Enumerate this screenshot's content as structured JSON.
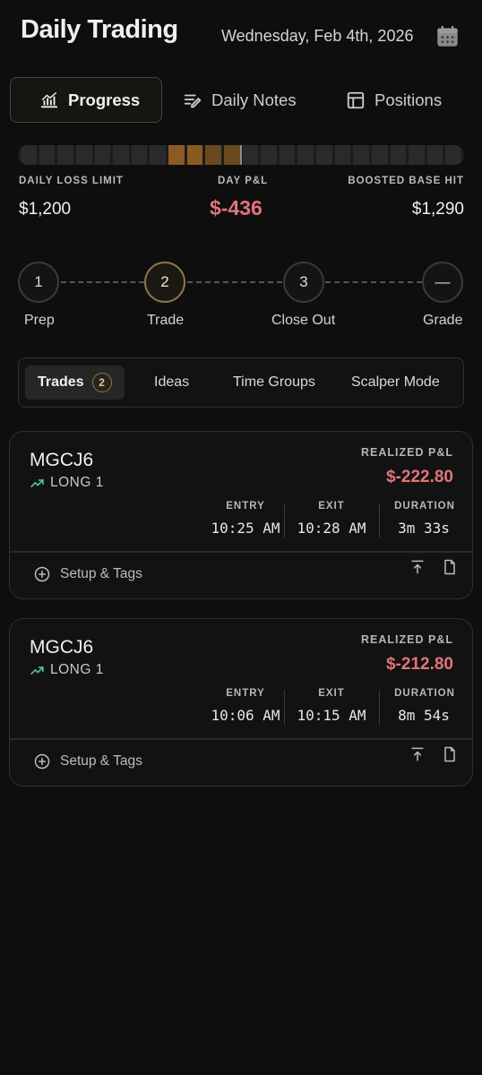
{
  "header": {
    "title": "Daily Trading",
    "date": "Wednesday, Feb 4th, 2026"
  },
  "tabs": [
    {
      "label": "Progress",
      "icon": "chart-icon",
      "active": true
    },
    {
      "label": "Daily Notes",
      "icon": "notes-icon",
      "active": false
    },
    {
      "label": "Positions",
      "icon": "table-icon",
      "active": false
    }
  ],
  "stats": {
    "loss_limit_label": "DAILY LOSS LIMIT",
    "loss_limit_value": "$1,200",
    "day_pl_label": "DAY P&L",
    "day_pl_value": "$-436",
    "boosted_label": "BOOSTED BASE HIT",
    "boosted_value": "$1,290"
  },
  "steps": [
    {
      "num": "1",
      "label": "Prep"
    },
    {
      "num": "2",
      "label": "Trade",
      "active": true
    },
    {
      "num": "3",
      "label": "Close Out"
    },
    {
      "num": "—",
      "label": "Grade"
    }
  ],
  "subtabs": {
    "trades": "Trades",
    "trades_count": "2",
    "ideas": "Ideas",
    "time_groups": "Time Groups",
    "scalper": "Scalper Mode"
  },
  "trades": [
    {
      "symbol": "MGCJ6",
      "side": "LONG 1",
      "pl_label": "REALIZED P&L",
      "pl_value": "$-222.80",
      "entry_label": "ENTRY",
      "entry": "10:25 AM",
      "exit_label": "EXIT",
      "exit": "10:28 AM",
      "duration_label": "DURATION",
      "duration": "3m 33s",
      "setup": "Setup & Tags"
    },
    {
      "symbol": "MGCJ6",
      "side": "LONG 1",
      "pl_label": "REALIZED P&L",
      "pl_value": "$-212.80",
      "entry_label": "ENTRY",
      "entry": "10:06 AM",
      "exit_label": "EXIT",
      "exit": "10:15 AM",
      "duration_label": "DURATION",
      "duration": "8m 54s",
      "setup": "Setup & Tags"
    }
  ],
  "colors": {
    "negative": "#e0747b",
    "positive": "#4fc28a",
    "accent": "#8a7550"
  }
}
